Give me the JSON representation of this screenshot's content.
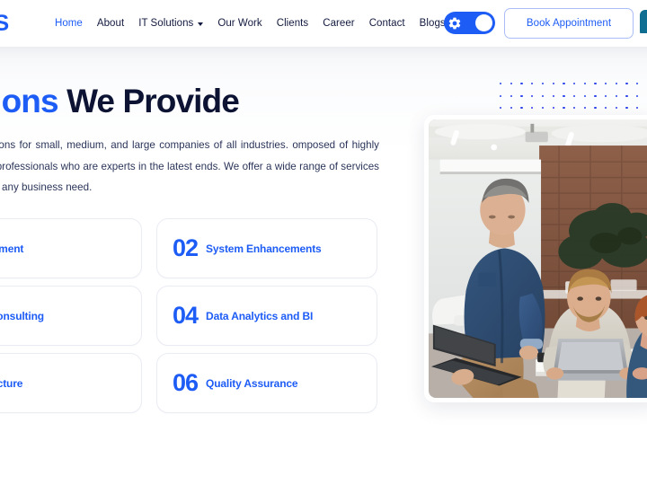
{
  "navbar": {
    "logo_text": "US",
    "links": [
      {
        "label": "Home",
        "active": true,
        "has_caret": false
      },
      {
        "label": "About",
        "active": false,
        "has_caret": false
      },
      {
        "label": "IT Solutions",
        "active": false,
        "has_caret": true
      },
      {
        "label": "Our Work",
        "active": false,
        "has_caret": false
      },
      {
        "label": "Clients",
        "active": false,
        "has_caret": false
      },
      {
        "label": "Career",
        "active": false,
        "has_caret": false
      },
      {
        "label": "Contact",
        "active": false,
        "has_caret": false
      },
      {
        "label": "Blogs",
        "active": false,
        "has_caret": false
      }
    ],
    "toggle": {
      "icon": "gear-icon",
      "state": "on"
    },
    "book_button_label": "Book Appointment"
  },
  "hero": {
    "heading_accent": "olutions",
    "heading_dark": "We Provide",
    "paragraph": "T solutions for small, medium, and large companies of all industries. omposed of highly skilled professionals who are experts in the latest ends. We offer a wide range of services to meet any business need."
  },
  "services": [
    {
      "number": "",
      "label": "ct Development"
    },
    {
      "number": "02",
      "label": "System Enhancements"
    },
    {
      "number": "",
      "label": "hnology Consulting"
    },
    {
      "number": "04",
      "label": "Data Analytics and BI"
    },
    {
      "number": "",
      "label": "d Infrastructure"
    },
    {
      "number": "06",
      "label": "Quality Assurance"
    }
  ],
  "decor": {
    "dot_color": "#2b43e8",
    "dot_rows": 3,
    "dot_cols": 15
  },
  "colors": {
    "accent_blue": "#1d5cf5",
    "dark_navy": "#0d1333",
    "body_text": "#2b3559",
    "card_border": "#e9ecf3",
    "page_bg": "#ffffff"
  },
  "media": {
    "hero_image_alt": "office-team-photo"
  }
}
